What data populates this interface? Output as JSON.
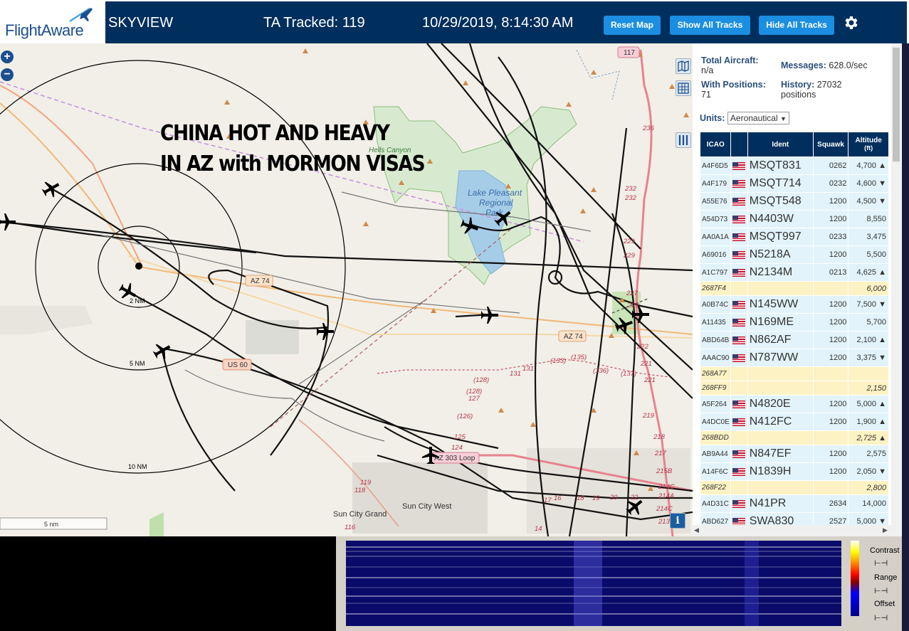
{
  "header": {
    "logo": "FlightAware",
    "app_title": "SKYVIEW",
    "tracked": "TA Tracked: 119",
    "datetime": "10/29/2019, 8:14:30 AM",
    "reset_label": "Reset Map",
    "show_label": "Show All Tracks",
    "hide_label": "Hide All Tracks"
  },
  "map": {
    "overlay_line1": "CHINA HOT AND HEAVY",
    "overlay_line2": "IN AZ with MORMON VISAS",
    "labels": {
      "hells_canyon": "Hells Canyon",
      "lake_pleasant": "Lake Pleasant",
      "regional": "Regional",
      "park": "Park",
      "az74_a": "AZ 74",
      "az74_b": "AZ 74",
      "us60": "US 60",
      "loop": "AZ 303 Loop",
      "sun_city_grand": "Sun City Grand",
      "sun_city_west": "Sun City West",
      "ring_2": "2 NM",
      "ring_5": "5 NM",
      "ring_10": "10 NM",
      "scale": "5 nm",
      "r117": "117"
    }
  },
  "stats": {
    "total_label": "Total Aircraft:",
    "total_value": "n/a",
    "messages_label": "Messages:",
    "messages_value": "628.0/sec",
    "positions_label": "With Positions:",
    "positions_value": "71",
    "history_label": "History:",
    "history_value": "27032",
    "history_unit": "positions",
    "units_label": "Units:",
    "units_value": "Aeronautical"
  },
  "table": {
    "headers": {
      "icao": "ICAO",
      "ident": "Ident",
      "squawk": "Squawk",
      "altitude": "Altitude",
      "altitude_unit": "(ft)"
    },
    "rows": [
      {
        "icao": "A4F6D5",
        "ident": "MSQT831",
        "squawk": "0262",
        "alt": "4,700 ▲",
        "pos": true
      },
      {
        "icao": "A4F179",
        "ident": "MSQT714",
        "squawk": "0232",
        "alt": "4,600 ▼",
        "pos": true
      },
      {
        "icao": "A55E76",
        "ident": "MSQT548",
        "squawk": "1200",
        "alt": "4,500 ▼",
        "pos": true
      },
      {
        "icao": "A54D73",
        "ident": "N4403W",
        "squawk": "1200",
        "alt": "8,550",
        "pos": true
      },
      {
        "icao": "AA0A1A",
        "ident": "MSQT997",
        "squawk": "0233",
        "alt": "3,475",
        "pos": true
      },
      {
        "icao": "A69016",
        "ident": "N5218A",
        "squawk": "1200",
        "alt": "5,500",
        "pos": true
      },
      {
        "icao": "A1C797",
        "ident": "N2134M",
        "squawk": "0213",
        "alt": "4,625 ▲",
        "pos": true
      },
      {
        "icao": "2687F4",
        "ident": "",
        "squawk": "",
        "alt": "6,000",
        "pos": false
      },
      {
        "icao": "A0B74C",
        "ident": "N145WW",
        "squawk": "1200",
        "alt": "7,500 ▼",
        "pos": true
      },
      {
        "icao": "A11435",
        "ident": "N169ME",
        "squawk": "1200",
        "alt": "5,700",
        "pos": true
      },
      {
        "icao": "ABD64B",
        "ident": "N862AF",
        "squawk": "1200",
        "alt": "2,100 ▲",
        "pos": true
      },
      {
        "icao": "AAAC90",
        "ident": "N787WW",
        "squawk": "1200",
        "alt": "3,375 ▼",
        "pos": true
      },
      {
        "icao": "268A77",
        "ident": "",
        "squawk": "",
        "alt": "",
        "pos": false
      },
      {
        "icao": "268FF9",
        "ident": "",
        "squawk": "",
        "alt": "2,150",
        "pos": false
      },
      {
        "icao": "A5F264",
        "ident": "N4820E",
        "squawk": "1200",
        "alt": "5,000 ▲",
        "pos": true
      },
      {
        "icao": "A4DC0E",
        "ident": "N412FC",
        "squawk": "1200",
        "alt": "1,900 ▲",
        "pos": true
      },
      {
        "icao": "268BDD",
        "ident": "",
        "squawk": "",
        "alt": "2,725 ▲",
        "pos": false
      },
      {
        "icao": "AB9A44",
        "ident": "N847EF",
        "squawk": "1200",
        "alt": "2,575",
        "pos": true
      },
      {
        "icao": "A14F6C",
        "ident": "N1839H",
        "squawk": "1200",
        "alt": "2,050 ▼",
        "pos": true
      },
      {
        "icao": "268F22",
        "ident": "",
        "squawk": "",
        "alt": "2,800",
        "pos": false
      },
      {
        "icao": "A4D31C",
        "ident": "N41PR",
        "squawk": "2634",
        "alt": "14,000",
        "pos": true
      },
      {
        "icao": "ABD627",
        "ident": "SWA830",
        "squawk": "2527",
        "alt": "5,000 ▼",
        "pos": true
      }
    ]
  },
  "waterfall": {
    "contrast_label": "Contrast",
    "range_label": "Range",
    "offset_label": "Offset"
  },
  "icons": [
    "plus-icon",
    "minus-icon",
    "map-layer-icon",
    "grid-icon",
    "columns-icon",
    "gear-icon",
    "info-icon",
    "airplane-icon"
  ],
  "colors": {
    "header_bg": "#002f5d",
    "button_bg": "#1b8ee1",
    "row_pos": "#e2f3fb",
    "row_nopos": "#fdf2c3"
  }
}
